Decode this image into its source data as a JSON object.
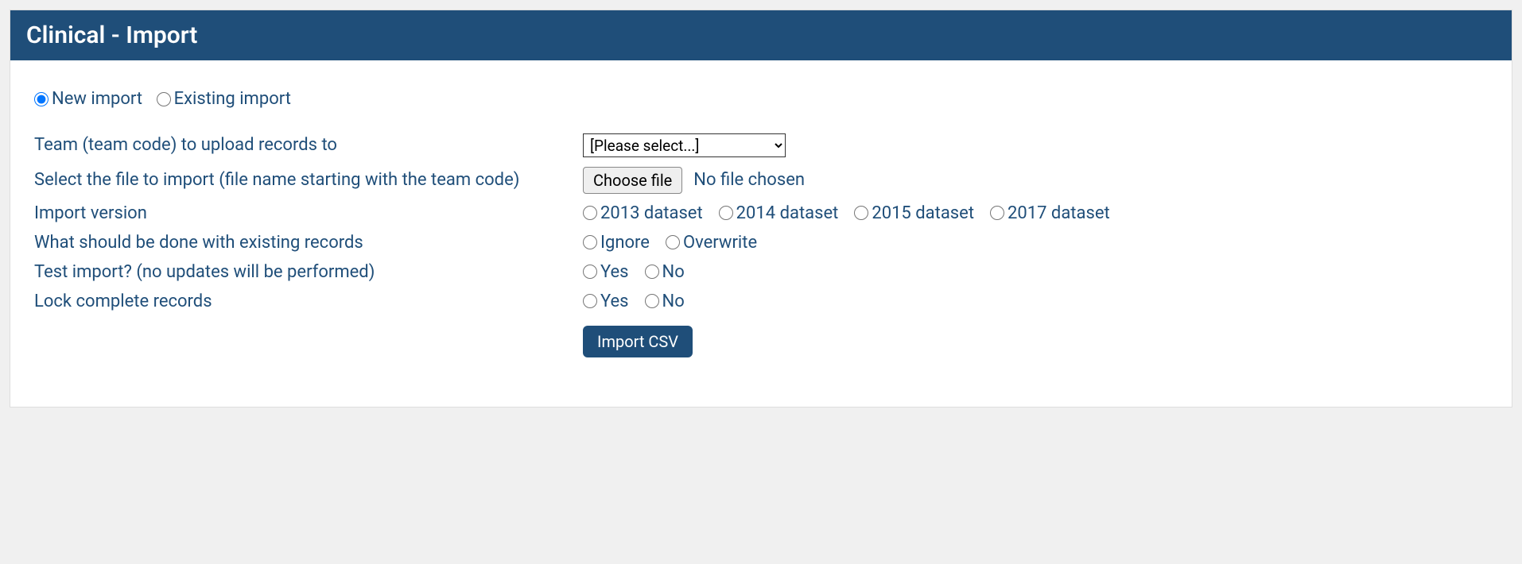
{
  "header": {
    "title": "Clinical - Import"
  },
  "import_type": {
    "options": {
      "new": "New import",
      "existing": "Existing import"
    },
    "selected": "new"
  },
  "form": {
    "team": {
      "label": "Team (team code) to upload records to",
      "placeholder": "[Please select...]"
    },
    "file": {
      "label": "Select the file to import (file name starting with the team code)",
      "button": "Choose file",
      "status": "No file chosen"
    },
    "version": {
      "label": "Import version",
      "options": {
        "v2013": "2013 dataset",
        "v2014": "2014 dataset",
        "v2015": "2015 dataset",
        "v2017": "2017 dataset"
      }
    },
    "existing_records": {
      "label": "What should be done with existing records",
      "options": {
        "ignore": "Ignore",
        "overwrite": "Overwrite"
      }
    },
    "test_import": {
      "label": "Test import? (no updates will be performed)",
      "options": {
        "yes": "Yes",
        "no": "No"
      }
    },
    "lock_records": {
      "label": "Lock complete records",
      "options": {
        "yes": "Yes",
        "no": "No"
      }
    },
    "submit": "Import CSV"
  }
}
